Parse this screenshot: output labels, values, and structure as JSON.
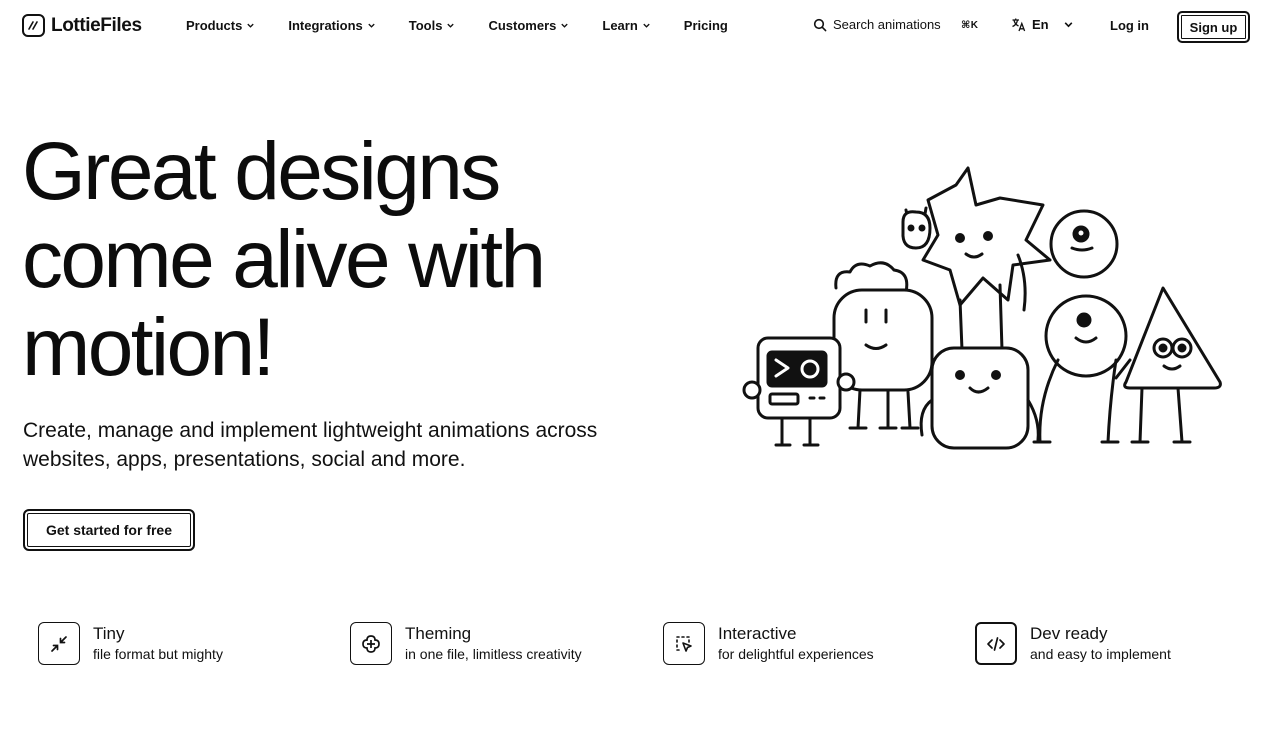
{
  "header": {
    "logo_text": "LottieFiles",
    "nav": [
      {
        "label": "Products",
        "has_dropdown": true
      },
      {
        "label": "Integrations",
        "has_dropdown": true
      },
      {
        "label": "Tools",
        "has_dropdown": true
      },
      {
        "label": "Customers",
        "has_dropdown": true
      },
      {
        "label": "Learn",
        "has_dropdown": true
      },
      {
        "label": "Pricing",
        "has_dropdown": false
      }
    ],
    "search_label": "Search animations",
    "search_shortcut": "⌘K",
    "language": "En",
    "login_label": "Log in",
    "signup_label": "Sign up"
  },
  "hero": {
    "title_lines": [
      "Great designs",
      "come alive with",
      "motion!"
    ],
    "subtitle": "Create, manage and implement lightweight animations across websites, apps, presentations, social and more.",
    "cta_label": "Get started for free",
    "illustration_icon": "animated-characters-illustration"
  },
  "features": [
    {
      "title": "Tiny",
      "description": "file format but mighty",
      "icon": "compress-arrows-icon"
    },
    {
      "title": "Theming",
      "description": "in one file, limitless creativity",
      "icon": "palette-flower-icon"
    },
    {
      "title": "Interactive",
      "description": "for delightful experiences",
      "icon": "cursor-select-icon"
    },
    {
      "title": "Dev ready",
      "description": "and easy to implement",
      "icon": "code-brackets-icon"
    }
  ],
  "colors": {
    "text": "#111111",
    "background": "#ffffff",
    "border": "#111111"
  }
}
